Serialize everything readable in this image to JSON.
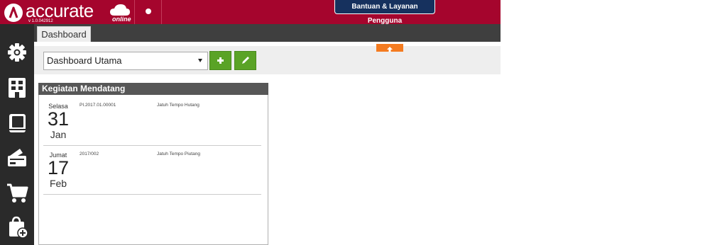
{
  "header": {
    "logo_text": "accurate",
    "logo_online": "online",
    "version": "v 1.0.042912",
    "help_button": "Bantuan & Layanan Pengguna"
  },
  "sidebar": {
    "items": [
      {
        "icon": "gear-icon"
      },
      {
        "icon": "building-icon"
      },
      {
        "icon": "book-icon"
      },
      {
        "icon": "wallet-icon"
      },
      {
        "icon": "cart-icon"
      },
      {
        "icon": "bag-add-icon"
      }
    ]
  },
  "tabs": [
    {
      "label": "Dashboard"
    }
  ],
  "toolbar": {
    "selected_dashboard": "Dashboard Utama"
  },
  "widget": {
    "title": "Kegiatan Mendatang",
    "events": [
      {
        "day": "Selasa",
        "date": "31",
        "month": "Jan",
        "ref": "PI.2017.01.00001",
        "desc": "Jatuh Tempo Hutang"
      },
      {
        "day": "Jumat",
        "date": "17",
        "month": "Feb",
        "ref": "2017/002",
        "desc": "Jatuh Tempo Piutang"
      }
    ]
  },
  "colors": {
    "brand": "#a5052d",
    "sidebar": "#2a2a2a",
    "accent_green": "#5aa326",
    "accent_orange": "#f47b20",
    "help_button": "#16315e"
  }
}
